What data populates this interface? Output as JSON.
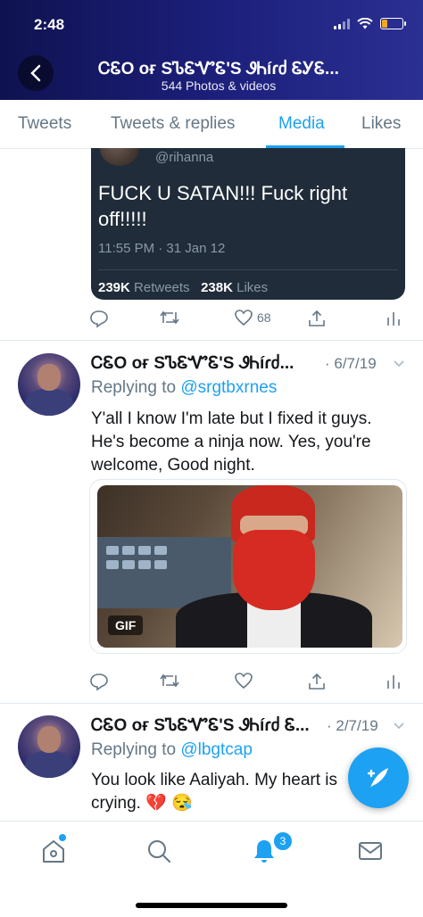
{
  "status_bar": {
    "time": "2:48"
  },
  "header": {
    "title": "ᏟᏋO ᴏғ SᏖᏋᏉᏋ'S ᏭᏂíɾძ ᏋᎩᏋ...",
    "subtitle": "544 Photos & videos"
  },
  "tabs": [
    {
      "label": "Tweets"
    },
    {
      "label": "Tweets & replies"
    },
    {
      "label": "Media"
    },
    {
      "label": "Likes"
    }
  ],
  "quoted_tweet": {
    "handle": "@rihanna",
    "text": "FUCK U SATAN!!! Fuck right off!!!!!",
    "timestamp": "11:55 PM · 31 Jan 12",
    "retweets": "239K",
    "retweets_label": "Retweets",
    "likes": "238K",
    "likes_label": "Likes"
  },
  "tweet1_actions": {
    "like_count": "68"
  },
  "tweets": [
    {
      "name": "ᏟᏋO ᴏғ SᏖᏋᏉᏋ'S ᏭᏂíɾძ...",
      "date": "· 6/7/19",
      "reply_prefix": "Replying to",
      "reply_handle": "@srgtbxrnes",
      "text": "Y'all I know I'm late but I fixed it guys. He's become a ninja now. Yes, you're welcome, Good night.",
      "media_badge": "GIF"
    },
    {
      "name": "ᏟᏋO ᴏғ SᏖᏋᏉᏋ'S ᏭᏂíɾძ Ꮛ...",
      "date": "· 2/7/19",
      "reply_prefix": "Replying to",
      "reply_handle": "@lbgtcap",
      "text": "You look like Aaliyah. My heart is crying. 💔 😪"
    }
  ],
  "bottom_nav": {
    "notifications_badge": "3"
  },
  "colors": {
    "accent": "#1da1f2",
    "header_bg": "#1c1f7a",
    "muted": "#657786"
  }
}
